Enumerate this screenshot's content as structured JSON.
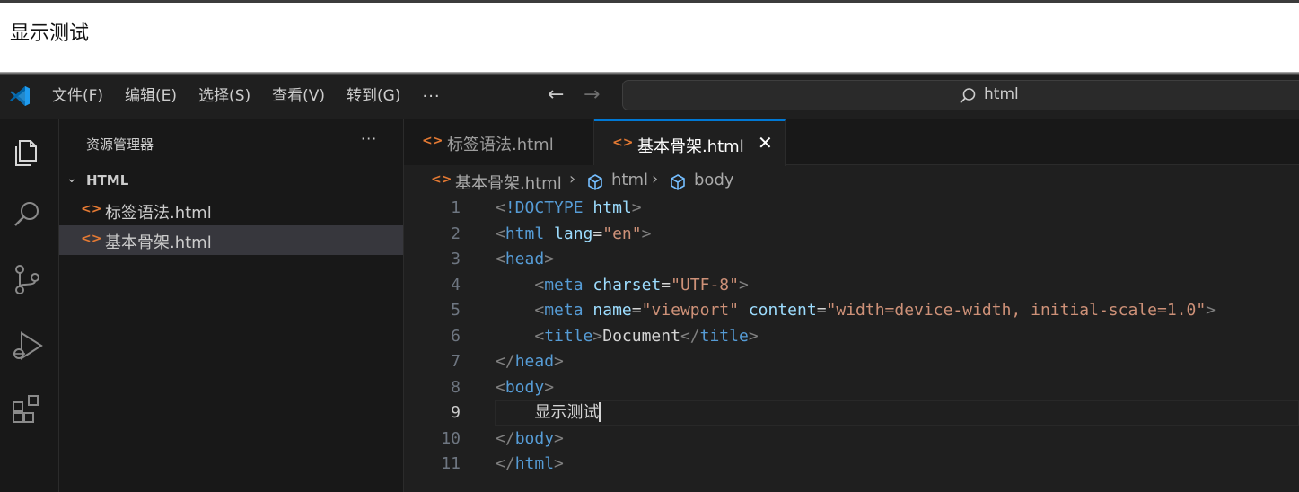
{
  "browser": {
    "page_text": "显示测试"
  },
  "menu": {
    "items": [
      "文件(F)",
      "编辑(E)",
      "选择(S)",
      "查看(V)",
      "转到(G)"
    ],
    "more": "···"
  },
  "command_center": {
    "text": "html"
  },
  "sidebar": {
    "title": "资源管理器",
    "more": "···",
    "folder": "HTML",
    "files": [
      "标签语法.html",
      "基本骨架.html"
    ],
    "active_file_index": 1
  },
  "tabs": [
    {
      "label": "标签语法.html",
      "active": false
    },
    {
      "label": "基本骨架.html",
      "active": true
    }
  ],
  "breadcrumb": {
    "file": "基本骨架.html",
    "path": [
      "html",
      "body"
    ]
  },
  "editor": {
    "current_line": 9,
    "lines": [
      {
        "n": "1",
        "tokens": [
          [
            "br",
            "<"
          ],
          [
            "tag",
            "!DOCTYPE"
          ],
          [
            "txt",
            " "
          ],
          [
            "attr",
            "html"
          ],
          [
            "br",
            ">"
          ]
        ]
      },
      {
        "n": "2",
        "tokens": [
          [
            "br",
            "<"
          ],
          [
            "tag",
            "html"
          ],
          [
            "txt",
            " "
          ],
          [
            "attr",
            "lang"
          ],
          [
            "txt",
            "="
          ],
          [
            "str",
            "\"en\""
          ],
          [
            "br",
            ">"
          ]
        ]
      },
      {
        "n": "3",
        "tokens": [
          [
            "br",
            "<"
          ],
          [
            "tag",
            "head"
          ],
          [
            "br",
            ">"
          ]
        ]
      },
      {
        "n": "4",
        "tokens": [
          [
            "txt",
            "    "
          ],
          [
            "br",
            "<"
          ],
          [
            "tag",
            "meta"
          ],
          [
            "txt",
            " "
          ],
          [
            "attr",
            "charset"
          ],
          [
            "txt",
            "="
          ],
          [
            "str",
            "\"UTF-8\""
          ],
          [
            "br",
            ">"
          ]
        ]
      },
      {
        "n": "5",
        "tokens": [
          [
            "txt",
            "    "
          ],
          [
            "br",
            "<"
          ],
          [
            "tag",
            "meta"
          ],
          [
            "txt",
            " "
          ],
          [
            "attr",
            "name"
          ],
          [
            "txt",
            "="
          ],
          [
            "str",
            "\"viewport\""
          ],
          [
            "txt",
            " "
          ],
          [
            "attr",
            "content"
          ],
          [
            "txt",
            "="
          ],
          [
            "str",
            "\"width=device-width, initial-scale=1.0\""
          ],
          [
            "br",
            ">"
          ]
        ]
      },
      {
        "n": "6",
        "tokens": [
          [
            "txt",
            "    "
          ],
          [
            "br",
            "<"
          ],
          [
            "tag",
            "title"
          ],
          [
            "br",
            ">"
          ],
          [
            "txt",
            "Document"
          ],
          [
            "br",
            "</"
          ],
          [
            "tag",
            "title"
          ],
          [
            "br",
            ">"
          ]
        ]
      },
      {
        "n": "7",
        "tokens": [
          [
            "br",
            "</"
          ],
          [
            "tag",
            "head"
          ],
          [
            "br",
            ">"
          ]
        ]
      },
      {
        "n": "8",
        "tokens": [
          [
            "br",
            "<"
          ],
          [
            "tag",
            "body"
          ],
          [
            "br",
            ">"
          ]
        ]
      },
      {
        "n": "9",
        "tokens": [
          [
            "txt",
            "    显示测试"
          ]
        ]
      },
      {
        "n": "10",
        "tokens": [
          [
            "br",
            "</"
          ],
          [
            "tag",
            "body"
          ],
          [
            "br",
            ">"
          ]
        ]
      },
      {
        "n": "11",
        "tokens": [
          [
            "br",
            "</"
          ],
          [
            "tag",
            "html"
          ],
          [
            "br",
            ">"
          ]
        ]
      }
    ]
  },
  "colors": {
    "accent": "#0078d4",
    "file_icon": "#e37933",
    "tag": "#569cd6",
    "attribute": "#9cdcfe",
    "string": "#ce9178",
    "bracket": "#808080"
  }
}
